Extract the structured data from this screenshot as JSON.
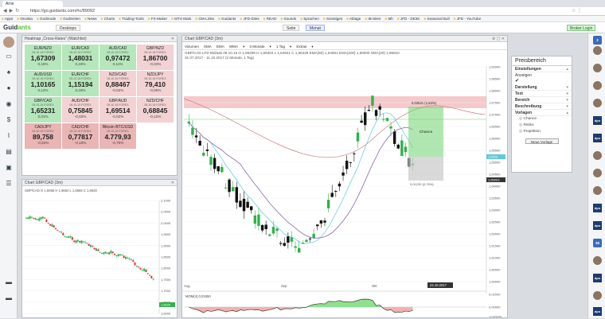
{
  "browser": {
    "tab_title": "Arne",
    "url": "https://go.guidants.com/#c/89092",
    "bookmarks": [
      "Apps",
      "Onvista",
      "Godmode",
      "GodSeiten",
      "News",
      "Charts",
      "Trading-Tools",
      "FX-Maker",
      "MT4-Stats",
      "GM-Links",
      "Guidants",
      "JFD-Sites",
      "READ",
      "Sounds",
      "Sprachen",
      "Sonstiges",
      "Ablage",
      "IB-Sites",
      "6th",
      "JFD - DE3K",
      "Seasonal Bull",
      "JFD - YouTube"
    ]
  },
  "app": {
    "logo": "Guidants",
    "workspace_1": "Desktops",
    "workspace_2": "Seite",
    "workspace_3": "Monat",
    "login": "Broker Login"
  },
  "heatmap": {
    "title": "Heatmap „Cross-Rates“ (Watchlist)",
    "cells": [
      {
        "sym": "EUR/NZD",
        "dt": "09.10.15 FOREX",
        "price": "1,67309",
        "chg": "0,16%",
        "tone": "pos1"
      },
      {
        "sym": "EUR/CAD",
        "dt": "09.10.15 FOREX",
        "price": "1,48031",
        "chg": "0,16%",
        "tone": "pos1"
      },
      {
        "sym": "AUD/CAD",
        "dt": "09.10.15 FOREX",
        "price": "0,97472",
        "chg": "0,11%",
        "tone": "pos1"
      },
      {
        "sym": "GBP/NZD",
        "dt": "09.10.15 FOREX",
        "price": "1,86700",
        "chg": "-0,03%",
        "tone": "neg1"
      },
      {
        "sym": "AUD/USD",
        "dt": "09.10.15 FOREX",
        "price": "1,10165",
        "chg": "0,12%",
        "tone": "pos1"
      },
      {
        "sym": "EUR/CHF",
        "dt": "09.10.15 FOREX",
        "price": "1,15194",
        "chg": "0,16%",
        "tone": "pos1"
      },
      {
        "sym": "NZD/CAD",
        "dt": "09.10.15 FOREX",
        "price": "0,88467",
        "chg": "-0,02%",
        "tone": "neg1"
      },
      {
        "sym": "NZD/JPY",
        "dt": "09.10.15 FOREX",
        "price": "79,410",
        "chg": "-0,05%",
        "tone": "neg1"
      },
      {
        "sym": "GBP/CAD",
        "dt": "09.10.15 FOREX",
        "price": "1,65231",
        "chg": "0,01%",
        "tone": "pos1"
      },
      {
        "sym": "AUD/CHF",
        "dt": "09.10.15 FOREX",
        "price": "0,75845",
        "chg": "-0,02%",
        "tone": "neg1"
      },
      {
        "sym": "GBP/AUD",
        "dt": "09.10.15 FOREX",
        "price": "1,69514",
        "chg": "-0,02%",
        "tone": "neg1"
      },
      {
        "sym": "NZD/CHF",
        "dt": "09.10.15 FOREX",
        "price": "0,68845",
        "chg": "-0,12%",
        "tone": "neg1"
      },
      {
        "sym": "CAD/JPY",
        "dt": "09.10.15 FOREX",
        "price": "89,758",
        "chg": "-0,63%",
        "tone": "neg2"
      },
      {
        "sym": "CAD/CHF",
        "dt": "09.10.15 FOREX",
        "price": "0,77817",
        "chg": "-0,18%",
        "tone": "neg2"
      },
      {
        "sym": "Bitcoin BTC/USD",
        "dt": "09.10.15 FOREX",
        "price": "4.779,93",
        "chg": "-0,75%",
        "tone": "neg2"
      }
    ]
  },
  "small_chart": {
    "title": "Chart GBP/CAD (3m)",
    "info_line1": "GBP/CAD O 1,6656 H 1,6654 L 1,6566 C 1,6620",
    "info_line2": "17.11.2014 - 09.10.2015 (5 Jahre, 1 Woche)",
    "price_labels": [
      "2,1000",
      "2,0500",
      "2,0000",
      "1,9500",
      "1,9000",
      "1,8500",
      "1,8000",
      "1,7500",
      "1,7000",
      "1,6500",
      "1,6000"
    ],
    "current": "1,6520"
  },
  "main_chart": {
    "title": "Chart GBP/CAD (3m)",
    "toolbar": [
      "Volumen",
      "SMA",
      "EMA",
      "WMA",
      "▾",
      "3 Monate",
      "▾",
      "1 Tag",
      "▾",
      "Extras",
      "▾"
    ],
    "info": "GBP/CAD LFD Bid/ask 09.10.15   O 1,65208  H 1,65303  L 1,64941  C 1,65229   EMA(50) 1,64961   EMA(200) 1,60000   SMA(20) 1,65810",
    "date_range": "31.07.2017 - 11.10.2017 (2 Monate, 1 Tag)",
    "price_axis": [
      "1,69000",
      "1,68500",
      "1,68000",
      "1,67500",
      "1,67000",
      "1,66500",
      "1,66000",
      "1,65500",
      "1,65000",
      "1,64500",
      "1,64000",
      "1,63500",
      "1,63000",
      "1,62500",
      "1,62000",
      "1,61500",
      "1,61000",
      "1,60500",
      "1,60000"
    ],
    "x_labels": [
      "Aug",
      "Sep",
      "Okt"
    ],
    "current_price": "1,6520",
    "current_price_2": "1,65003",
    "crosshair_date": "24.10.2017",
    "rr_top": "0,02521 (1,53%)",
    "rr_bottom": "0,01230 (0,75%)",
    "rr_label": "Chance",
    "momentum_title": "MOM(4) 0,01550",
    "momentum_axis": [
      "0,02000",
      "0,00000",
      "-0,02000"
    ]
  },
  "preisbereich": {
    "title": "Preisbereich",
    "sections": [
      "Einstellungen",
      "Anzeigen",
      "Darstellung",
      "Text",
      "Bereich",
      "Beschreibung",
      "Vorlagen"
    ],
    "items": [
      "Chance",
      "Risiko",
      "Projektion"
    ],
    "button": "Neue Vorlage"
  },
  "colors": {
    "up": "#2fb24a",
    "down": "#111111",
    "accent": "#5dbf3a",
    "resistance": "#e9a3a6",
    "target": "#6fd36f"
  }
}
